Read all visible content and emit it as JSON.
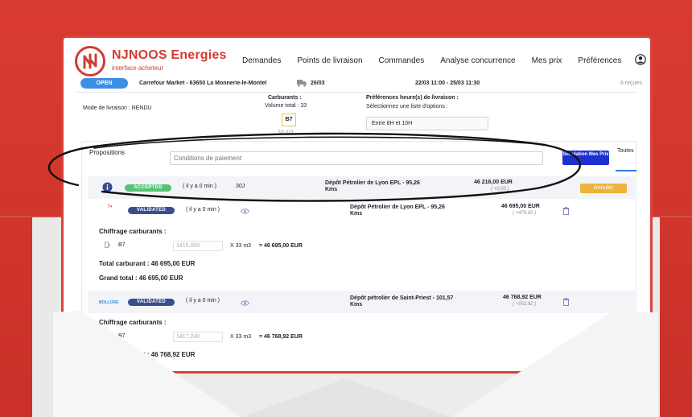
{
  "brand": {
    "name": "NJNOOS Energies",
    "subtitle": "interface acheteur"
  },
  "nav": [
    "Demandes",
    "Points de livraison",
    "Commandes",
    "Analyse concurrence",
    "Mes prix",
    "Préférences"
  ],
  "order": {
    "status": "OPEN",
    "client": "Carrefour Market - 63650 La Monnerie-le-Montel",
    "delivery_date": "26/03",
    "window": "22/03 11:00 - 25/03 11:30",
    "responses": "6 reçues"
  },
  "delivery": {
    "mode_label": "Mode de livraison : RENDU",
    "fuels_label": "Carburants :",
    "volume_label": "Volume total : 33",
    "fuel_chip": "B7",
    "fuel_volume": "33 m3",
    "pref_label": "Préférences heure(s) de livraison :",
    "pref_hint": "Sélectionnez une liste d'options :",
    "pref_value": "Entre 8H et 10H"
  },
  "propositions": {
    "title": "Propositions",
    "conditions_placeholder": "Conditions de paiement",
    "simulation_button": "Simulation Mes Prix",
    "filter_all": "Toutes",
    "rows": [
      {
        "status": "ACCEPTED",
        "time": "( il y a 0 min )",
        "delay": "30J",
        "depot": "Dépôt Pétrolier de Lyon EPL - 95,26 Kms",
        "price": "46 216,00 EUR",
        "diff": "( +0,00 )",
        "action": "Annuler"
      },
      {
        "logo": "7+",
        "status": "VALIDATED",
        "time": "( il y a 0 min )",
        "depot": "Dépôt Pétrolier de Lyon EPL - 95,26 Kms",
        "price": "46 695,00 EUR",
        "diff": "( +479,00 )",
        "chiffrage_title": "Chiffrage carburants :",
        "fuel": "B7",
        "unit_price": "1415,000",
        "qty": "X 33 m3",
        "line_total": "= 46 695,00 EUR",
        "total_carburant": "Total carburant : 46 695,00 EUR",
        "grand_total": "Grand total  : 46 695,00  EUR"
      },
      {
        "logo": "BOLLORE",
        "status": "VALIDATED",
        "time": "( il y a 0 min )",
        "depot": "Dépôt pétrolier de Saint-Priest - 101,57 Kms",
        "price": "46 768,92 EUR",
        "diff": "( +552,92 )",
        "chiffrage_title": "Chiffrage carburants :",
        "fuel": "B7",
        "unit_price": "1417,240",
        "qty": "X 33 m3",
        "line_total": "= 46 768,92 EUR",
        "total_carburant": "Total carburant : 46 768,92 EUR"
      }
    ]
  },
  "colors": {
    "brand_red": "#d33b31",
    "accepted": "#57c178",
    "validated": "#3a4d8e",
    "primary_blue": "#1d2fcf",
    "cancel_orange": "#f0b33c"
  }
}
